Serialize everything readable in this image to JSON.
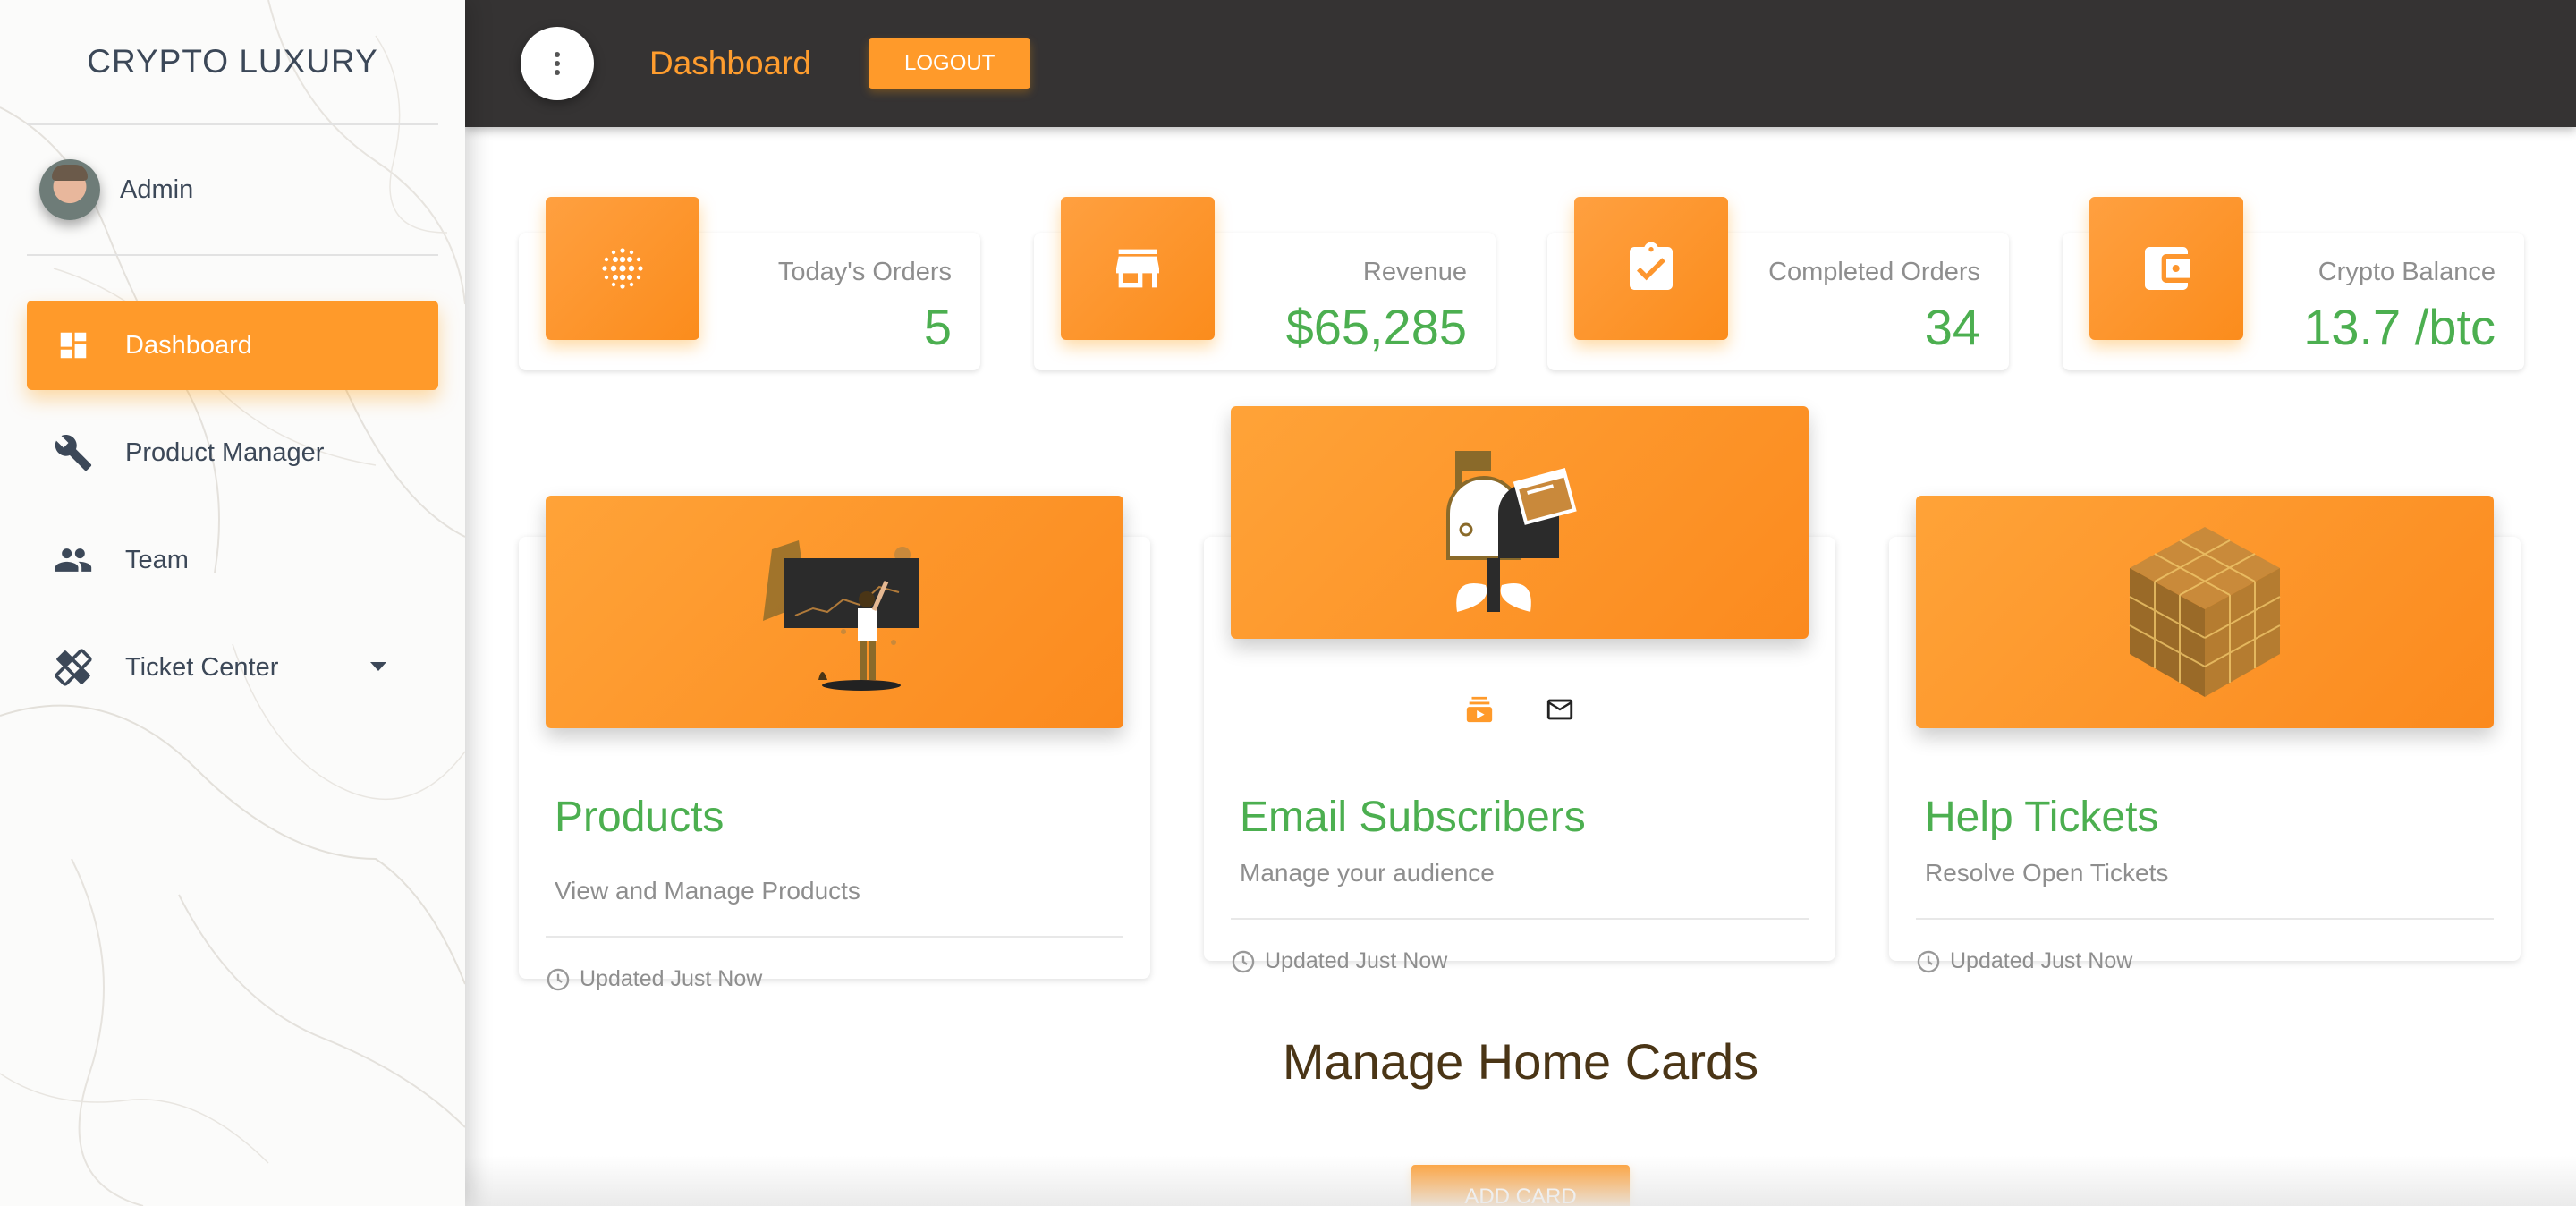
{
  "sidebar": {
    "brand": "CRYPTO LUXURY",
    "user_name": "Admin",
    "items": [
      {
        "label": "Dashboard",
        "icon": "dashboard-icon",
        "active": true
      },
      {
        "label": "Product Manager",
        "icon": "wrench-icon",
        "active": false
      },
      {
        "label": "Team",
        "icon": "people-icon",
        "active": false
      },
      {
        "label": "Ticket Center",
        "icon": "ticket-icon",
        "active": false,
        "has_dropdown": true
      }
    ]
  },
  "header": {
    "title": "Dashboard",
    "logout_label": "LOGOUT"
  },
  "stats": [
    {
      "label": "Today's Orders",
      "value": "5",
      "icon": "dot-grid-icon"
    },
    {
      "label": "Revenue",
      "value": "$65,285",
      "icon": "store-icon"
    },
    {
      "label": "Completed Orders",
      "value": "34",
      "icon": "clipboard-check-icon"
    },
    {
      "label": "Crypto Balance",
      "value": "13.7 /btc",
      "icon": "wallet-icon"
    }
  ],
  "cards": [
    {
      "title": "Products",
      "subtitle": "View and Manage Products",
      "updated": "Updated Just Now",
      "illustration": "presentation-board-illustration"
    },
    {
      "title": "Email Subscribers",
      "subtitle": "Manage your audience",
      "updated": "Updated Just Now",
      "illustration": "mailbox-illustration"
    },
    {
      "title": "Help Tickets",
      "subtitle": "Resolve Open Tickets",
      "updated": "Updated Just Now",
      "illustration": "cube-illustration"
    }
  ],
  "manage": {
    "title": "Manage Home Cards",
    "add_card_label": "ADD CARD"
  },
  "colors": {
    "accent": "#ff9a2a",
    "topbar": "#353333",
    "value_green": "#4caf50",
    "heading_brown": "#4a3516"
  }
}
